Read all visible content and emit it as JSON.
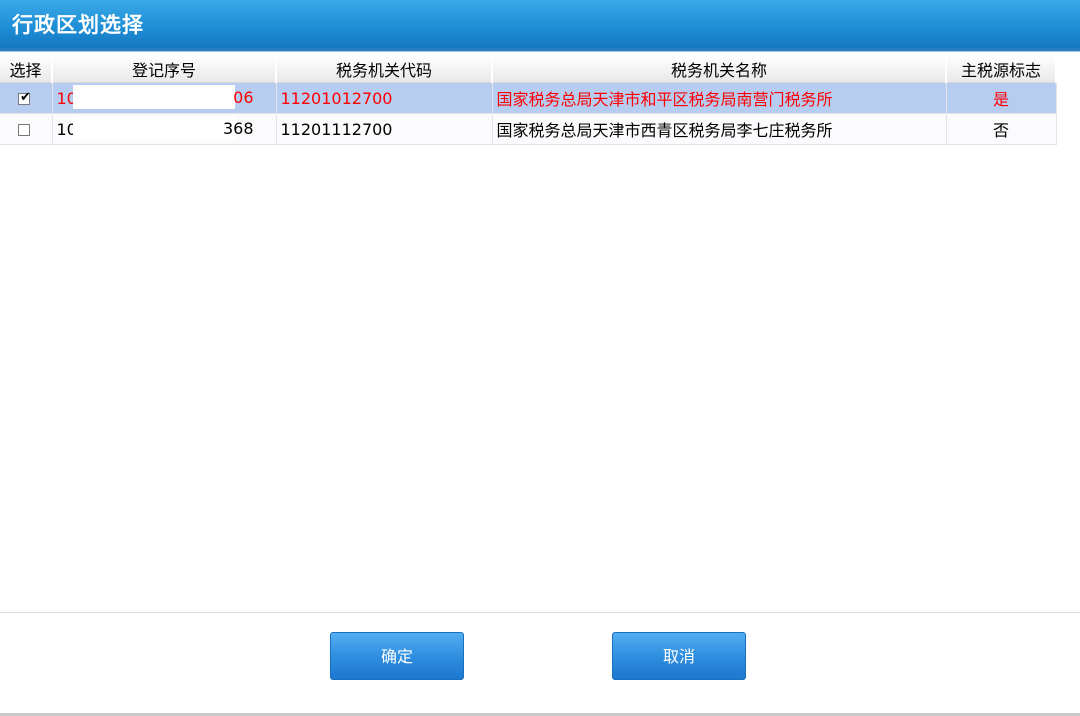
{
  "window": {
    "title": "行政区划选择"
  },
  "table": {
    "headers": [
      "选择",
      "登记序号",
      "税务机关代码",
      "税务机关名称",
      "主税源标志"
    ],
    "rows": [
      {
        "checked": true,
        "reg_prefix": "10",
        "reg_suffix": "06",
        "code": "11201012700",
        "name": "国家税务总局天津市和平区税务局南营门税务所",
        "main_flag": "是"
      },
      {
        "checked": false,
        "reg_prefix": "10",
        "reg_suffix": "368",
        "code": "11201112700",
        "name": "国家税务总局天津市西青区税务局李七庄税务所",
        "main_flag": "否"
      }
    ]
  },
  "buttons": {
    "confirm_label": "确定",
    "cancel_label": "取消"
  },
  "colors": {
    "title_bar": "#1f8fd6",
    "selected_row": "#b6cdf0",
    "selected_text": "#ff0000",
    "button": "#2f8fe0"
  }
}
